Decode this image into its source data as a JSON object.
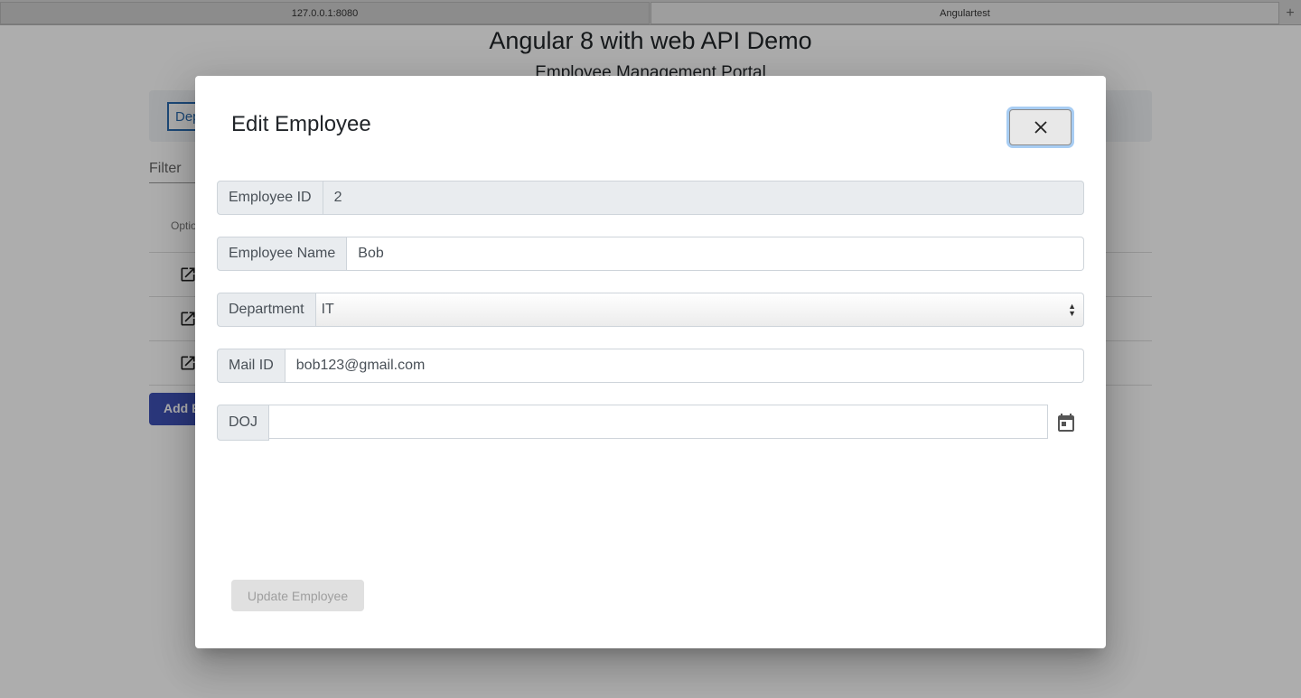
{
  "browser": {
    "tabs": [
      {
        "label": "127.0.0.1:8080"
      },
      {
        "label": "Angulartest"
      }
    ],
    "new_tab_label": "+"
  },
  "page": {
    "title": "Angular 8 with web API Demo",
    "subtitle": "Employee Management Portal",
    "nav_button": "Departments",
    "filter_label": "Filter",
    "options_header": "Options",
    "add_button": "Add Employee"
  },
  "dialog": {
    "title": "Edit Employee",
    "fields": {
      "employee_id": {
        "label": "Employee ID",
        "value": "2"
      },
      "employee_name": {
        "label": "Employee Name",
        "value": "Bob"
      },
      "department": {
        "label": "Department",
        "value": "IT"
      },
      "mail_id": {
        "label": "Mail ID",
        "value": "bob123@gmail.com"
      },
      "doj": {
        "label": "DOJ",
        "value": ""
      }
    },
    "update_button": "Update Employee"
  },
  "icons": [
    "close-icon",
    "calendar-icon",
    "edit-icon"
  ],
  "colors": {
    "primary_button": "#3f51b5",
    "focus_ring": "#a8cdf3",
    "addon_bg": "#e9ecef"
  }
}
